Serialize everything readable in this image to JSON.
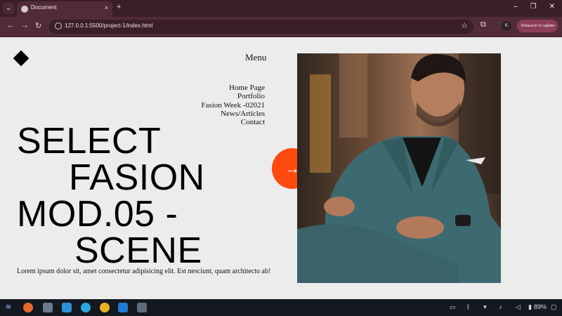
{
  "browser": {
    "tab_menu_icon": "chevron-down-icon",
    "tab_title": "Document",
    "tab_close": "×",
    "new_tab": "+",
    "window_controls": [
      "–",
      "❐",
      "✕"
    ],
    "url": "127.0.0.1:5500/project-1/index.html",
    "profile_initial": "K",
    "relaunch_label": "Relaunch to update",
    "kebab": "⋮"
  },
  "page": {
    "menu_title": "Menu",
    "nav_items": [
      "Home Page",
      "Portfolio",
      "Fasion Week -02021",
      "News/Articles",
      "Contact"
    ],
    "headline": {
      "line1": "SELECT",
      "line2": "FASION",
      "line3": "MOD.05 -",
      "line4": "SCENE"
    },
    "lorem": "Lorem ipsum dolor sit, amet consectetur adipisicing elit. Est nesciunt, quam architecto ab!",
    "cta_arrow": "→",
    "accent_color": "#ff4a0f"
  },
  "taskbar": {
    "battery_percent": "89%"
  }
}
